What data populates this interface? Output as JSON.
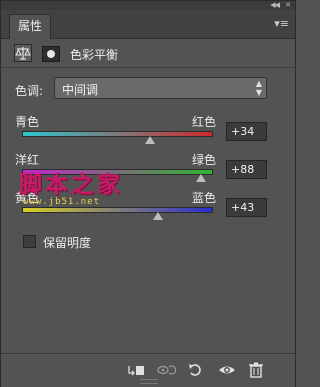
{
  "panel": {
    "tab_label": "属性",
    "title": "色彩平衡",
    "tone_label": "色调:",
    "tone_value": "中间调",
    "preserve_label": "保留明度"
  },
  "sliders": [
    {
      "left_label": "青色",
      "right_label": "红色",
      "value": "+34",
      "level": 34
    },
    {
      "left_label": "洋红",
      "right_label": "绿色",
      "value": "+88",
      "level": 88
    },
    {
      "left_label": "黄色",
      "right_label": "蓝色",
      "value": "+43",
      "level": 43
    }
  ],
  "watermark": {
    "main": "脚本之家",
    "url": "www.jb51.net"
  },
  "icons": {
    "collapse": "double-chevron-left-icon",
    "close": "close-icon",
    "panel_menu": "panel-menu-icon",
    "adjustment": "balance-scale-icon",
    "mask": "layer-mask-icon",
    "clip": "clip-to-layer-icon",
    "view_previous": "view-previous-state-icon",
    "reset": "reset-icon",
    "visibility": "eye-icon",
    "delete": "trash-icon"
  },
  "colors": {
    "panel_bg": "#535353",
    "cyan": "#2ec7d0",
    "red": "#d02a2a",
    "magenta": "#c425c7",
    "green": "#2fb52f",
    "yellow": "#d9cf22",
    "blue": "#2a2ed0"
  }
}
